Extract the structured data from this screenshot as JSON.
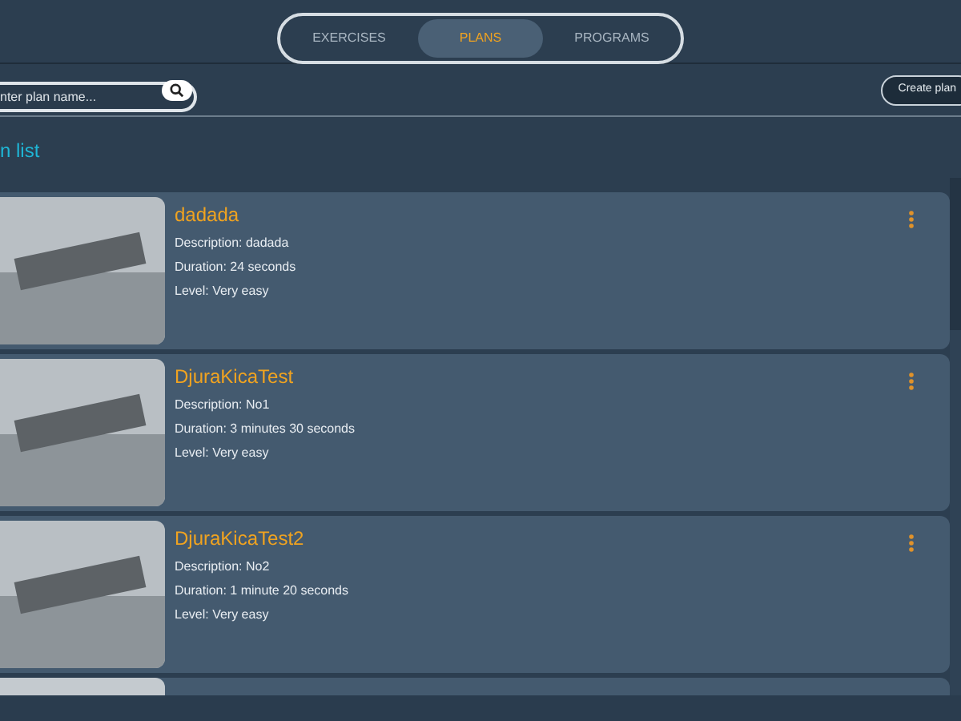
{
  "tabs": [
    {
      "label": "EXERCISES",
      "selected": false
    },
    {
      "label": "PLANS",
      "selected": true
    },
    {
      "label": "PROGRAMS",
      "selected": false
    }
  ],
  "search": {
    "placeholder": "nter plan name..."
  },
  "create_button": "Create plan",
  "section_title": "n list",
  "plans": [
    {
      "title": "dadada",
      "description": "Description: dadada",
      "duration": "Duration: 24 seconds",
      "level": "Level: Very easy"
    },
    {
      "title": "DjuraKicaTest",
      "description": "Description: No1",
      "duration": "Duration: 3 minutes 30 seconds",
      "level": "Level: Very easy"
    },
    {
      "title": "DjuraKicaTest2",
      "description": "Description: No2",
      "duration": "Duration: 1 minute 20 seconds",
      "level": "Level: Very easy"
    }
  ],
  "more_below": true
}
